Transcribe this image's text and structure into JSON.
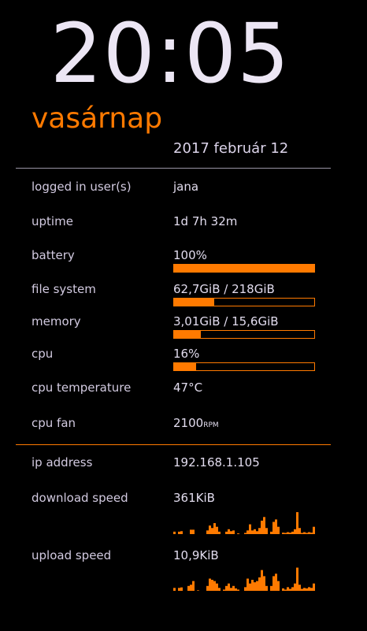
{
  "clock": {
    "time": "20:05",
    "day": "vasárnap",
    "date": "2017 február 12"
  },
  "rows": [
    {
      "label": "logged in user(s)",
      "value": "jana"
    },
    {
      "label": "uptime",
      "value": "1d 7h 32m"
    },
    {
      "label": "battery",
      "value": "100%",
      "fill": 1.0
    },
    {
      "label": "file system",
      "value": "62,7GiB / 218GiB",
      "fill": 0.288
    },
    {
      "label": "memory",
      "value": "3,01GiB / 15,6GiB",
      "fill": 0.193
    },
    {
      "label": "cpu",
      "value": "16%",
      "fill": 0.16
    },
    {
      "label": "cpu temperature",
      "value": "47°C"
    },
    {
      "label": "cpu fan",
      "value": "2100",
      "unit": "RPM"
    }
  ],
  "network": [
    {
      "label": "ip address",
      "value": "192.168.1.105"
    },
    {
      "label": "download speed",
      "value": "361KiB",
      "graph": [
        10,
        0,
        10,
        12,
        0,
        0,
        0,
        18,
        18,
        0,
        0,
        0,
        0,
        0,
        15,
        35,
        25,
        45,
        30,
        10,
        0,
        0,
        10,
        20,
        12,
        15,
        0,
        3,
        0,
        0,
        5,
        15,
        40,
        15,
        20,
        12,
        25,
        55,
        70,
        25,
        0,
        10,
        50,
        60,
        30,
        0,
        6,
        5,
        8,
        6,
        10,
        20,
        90,
        25,
        5,
        8,
        5,
        8,
        6,
        30
      ]
    },
    {
      "label": "upload speed",
      "value": "10,9KiB",
      "graph": [
        12,
        0,
        12,
        14,
        0,
        0,
        20,
        25,
        40,
        0,
        2,
        0,
        0,
        0,
        20,
        50,
        45,
        40,
        30,
        12,
        0,
        5,
        20,
        30,
        12,
        20,
        10,
        5,
        0,
        0,
        15,
        50,
        30,
        45,
        35,
        40,
        55,
        85,
        60,
        20,
        0,
        20,
        60,
        70,
        40,
        0,
        10,
        5,
        15,
        8,
        15,
        30,
        95,
        25,
        8,
        12,
        10,
        15,
        12,
        30
      ]
    }
  ],
  "colors": {
    "accent": "#ff7a00",
    "divider": "#9a94a4"
  }
}
